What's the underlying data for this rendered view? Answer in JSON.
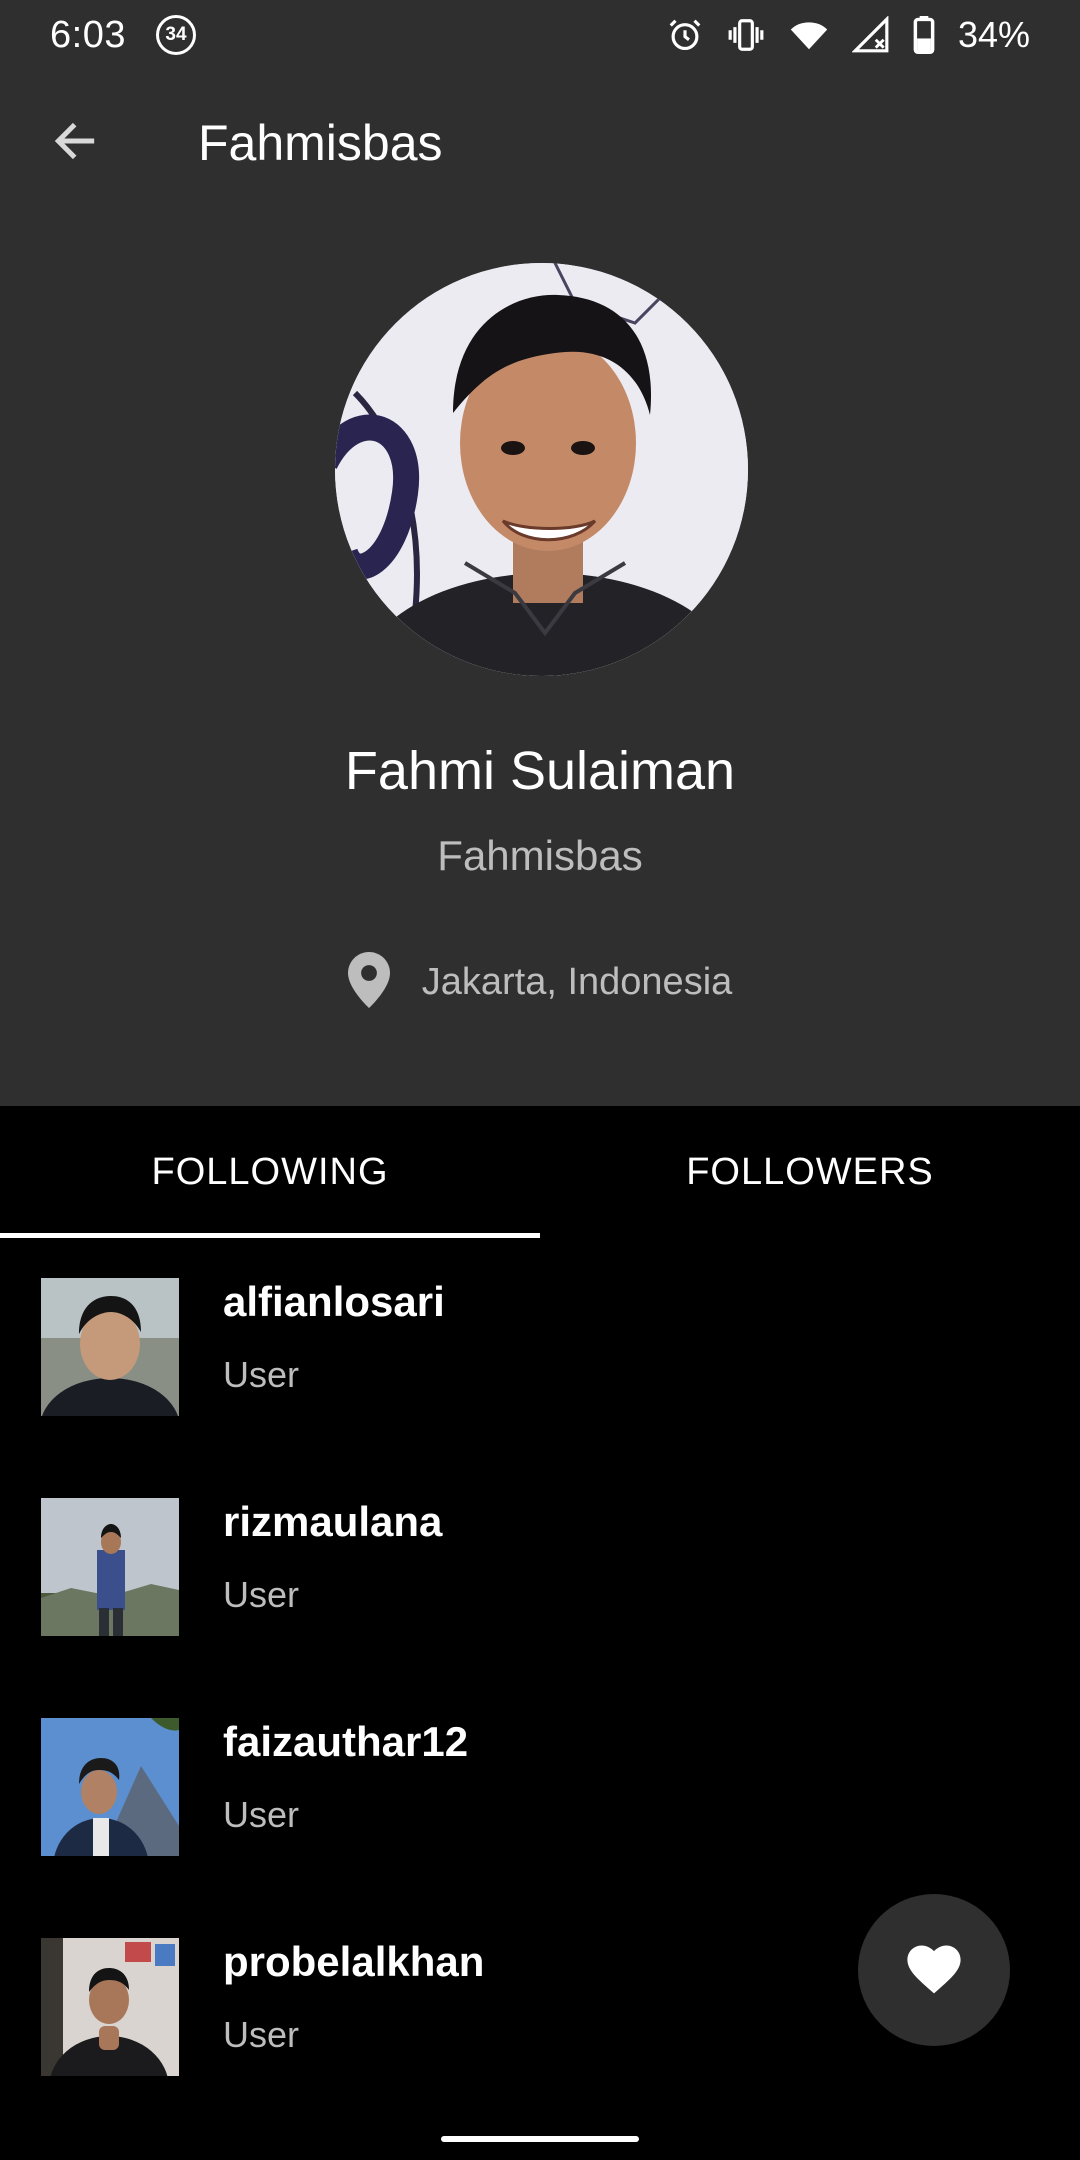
{
  "status_bar": {
    "time": "6:03",
    "notification_count": "34",
    "battery": "34%"
  },
  "app_bar": {
    "title": "Fahmisbas",
    "back_icon": "arrow-back-icon"
  },
  "profile": {
    "name": "Fahmi Sulaiman",
    "username": "Fahmisbas",
    "location": "Jakarta, Indonesia",
    "location_icon": "location-pin-icon"
  },
  "tabs": [
    {
      "label": "FOLLOWING",
      "selected": true
    },
    {
      "label": "FOLLOWERS",
      "selected": false
    }
  ],
  "following": [
    {
      "username": "alfianlosari",
      "type": "User"
    },
    {
      "username": "rizmaulana",
      "type": "User"
    },
    {
      "username": "faizauthar12",
      "type": "User"
    },
    {
      "username": "probelalkhan",
      "type": "User"
    }
  ],
  "fab": {
    "icon": "heart-icon"
  },
  "colors": {
    "header_bg": "#2f2f2f",
    "list_bg": "#000000",
    "text_primary": "#ffffff",
    "text_secondary": "#bdbdbd"
  }
}
